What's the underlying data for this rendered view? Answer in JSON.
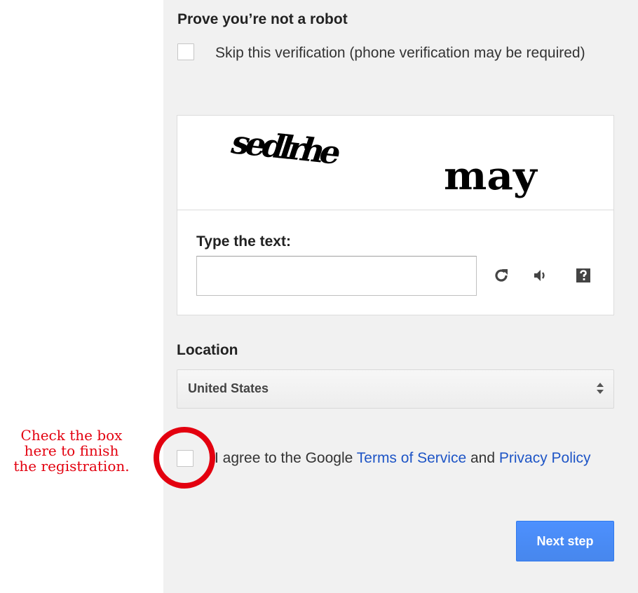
{
  "annotation": {
    "lines": [
      "Check the box",
      "here to finish",
      "the registration."
    ],
    "color": "#e3000f"
  },
  "captcha_section": {
    "title": "Prove you’re not a robot",
    "skip_label": "Skip this verification (phone verification may be required)",
    "skip_checked": false,
    "captcha_words": [
      "sedlrhe",
      "may"
    ],
    "type_label": "Type the text:",
    "input_value": "",
    "icons": [
      "refresh-icon",
      "audio-icon",
      "help-icon"
    ]
  },
  "location": {
    "label": "Location",
    "selected": "United States"
  },
  "agree": {
    "checked": false,
    "text_before": "I agree to the Google ",
    "terms_link": "Terms of Service",
    "text_middle": " and ",
    "privacy_link": "Privacy Policy"
  },
  "buttons": {
    "next_label": "Next step"
  },
  "colors": {
    "panel_bg": "#f1f1f1",
    "link": "#1e55c6",
    "primary_button": "#4a8af4",
    "highlight": "#e3000f"
  }
}
